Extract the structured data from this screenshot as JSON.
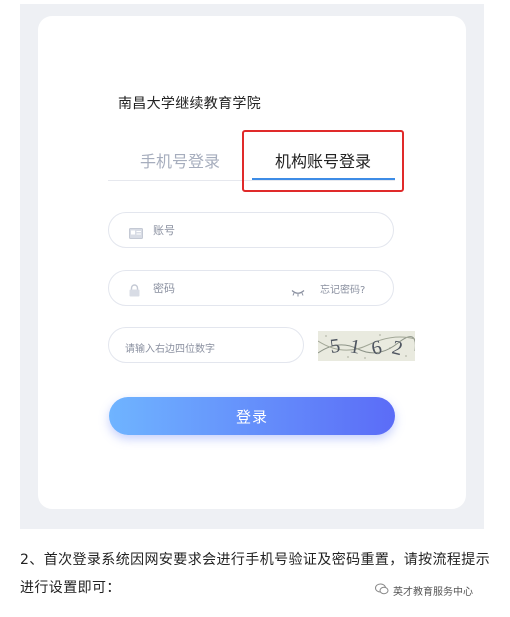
{
  "org_title": "南昌大学继续教育学院",
  "tabs": [
    {
      "label": "手机号登录",
      "active": false
    },
    {
      "label": "机构账号登录",
      "active": true
    }
  ],
  "fields": {
    "account_label": "账号",
    "password_label": "密码",
    "forgot_link": "忘记密码?",
    "captcha_placeholder": "请输入右边四位数字"
  },
  "captcha": {
    "text": "5162"
  },
  "login_button": "登录",
  "instruction": "2、首次登录系统因网安要求会进行手机号验证及密码重置，请按流程提示进行设置即可：",
  "watermark": "英才教育服务中心",
  "colors": {
    "accent": "#3d8ce6",
    "highlight_box": "#e02a2a",
    "button_start": "#6fb4ff",
    "button_end": "#5b6cf7"
  }
}
